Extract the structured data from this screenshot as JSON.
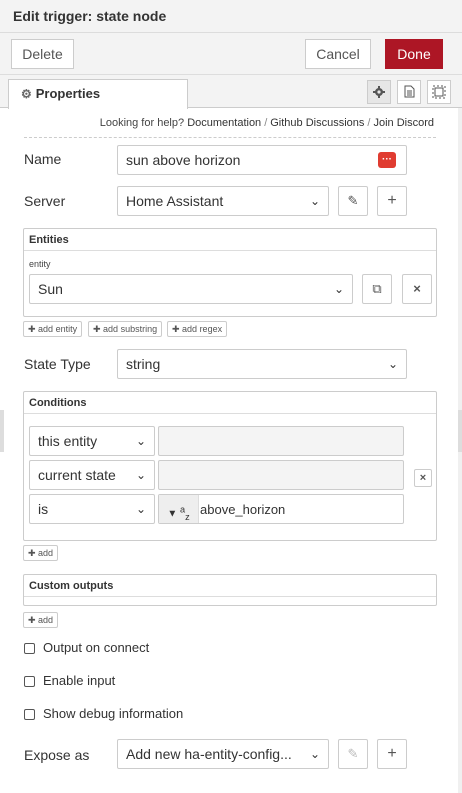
{
  "window": {
    "title": "Edit trigger: state node"
  },
  "actions": {
    "delete": "Delete",
    "cancel": "Cancel",
    "done": "Done"
  },
  "tabs": {
    "properties": "Properties"
  },
  "help": {
    "prefix": "Looking for help?",
    "links": [
      "Documentation",
      "Github Discussions",
      "Join Discord"
    ],
    "separator": "/"
  },
  "form": {
    "name_label": "Name",
    "name_value": "sun above horizon",
    "server_label": "Server",
    "server_value": "Home Assistant",
    "entities": {
      "header": "Entities",
      "entity_label": "entity",
      "entity_value": "Sun",
      "add_entity": "add entity",
      "add_substring": "add substring",
      "add_regex": "add regex"
    },
    "state_type_label": "State Type",
    "state_type_value": "string",
    "conditions": {
      "header": "Conditions",
      "rows": [
        {
          "select": "this entity",
          "value": ""
        },
        {
          "select": "current state",
          "value": ""
        },
        {
          "select": "is",
          "value": "above_horizon",
          "type_icon": "az"
        }
      ],
      "add": "add"
    },
    "custom_outputs": {
      "header": "Custom outputs",
      "add": "add"
    },
    "checkboxes": [
      {
        "label": "Output on connect",
        "checked": false
      },
      {
        "label": "Enable input",
        "checked": false
      },
      {
        "label": "Show debug information",
        "checked": false
      }
    ],
    "expose_label": "Expose as",
    "expose_value": "Add new ha-entity-config..."
  },
  "colors": {
    "accent": "#ad1625",
    "icon_red": "#e03c31"
  }
}
